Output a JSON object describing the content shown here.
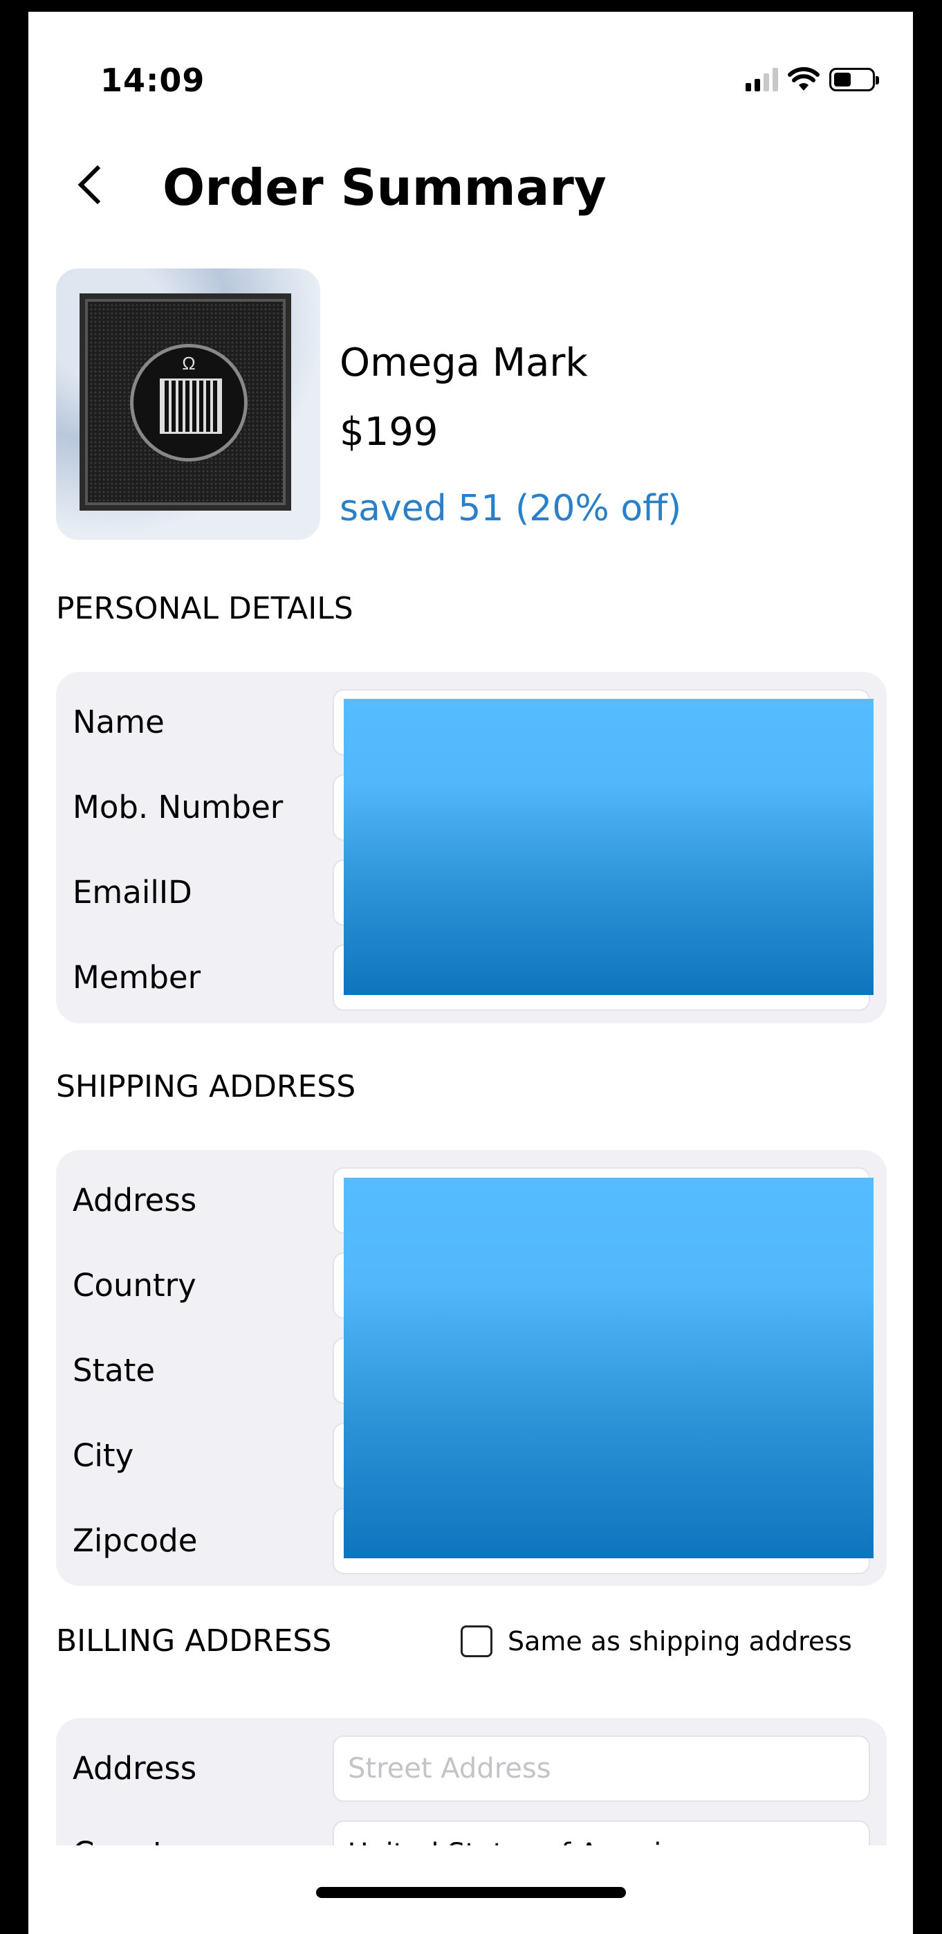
{
  "status_bar": {
    "time": "14:09"
  },
  "header": {
    "title": "Order Summary"
  },
  "product": {
    "name": "Omega Mark",
    "price": "$199",
    "savings": "saved 51 (20% off)",
    "image_symbol": "Ω"
  },
  "personal_details": {
    "title": "PERSONAL DETAILS",
    "fields": [
      {
        "label": "Name"
      },
      {
        "label": "Mob. Number"
      },
      {
        "label": "EmailID"
      },
      {
        "label": "Member"
      }
    ]
  },
  "shipping_address": {
    "title": "SHIPPING ADDRESS",
    "fields": [
      {
        "label": "Address"
      },
      {
        "label": "Country"
      },
      {
        "label": "State"
      },
      {
        "label": "City"
      },
      {
        "label": "Zipcode"
      }
    ]
  },
  "billing_address": {
    "title": "BILLING ADDRESS",
    "same_as_shipping_label": "Same as shipping address",
    "same_as_shipping_checked": false,
    "fields": [
      {
        "label": "Address",
        "placeholder": "Street Address",
        "value": ""
      },
      {
        "label": "Country",
        "value": "United States of America"
      }
    ]
  },
  "colors": {
    "accent": "#2a7fc9",
    "card_background": "#f0f0f5",
    "redaction_top": "#55bcff",
    "redaction_bottom": "#0e74bd"
  },
  "icons": {
    "back": "chevron-left-icon",
    "signal": "cellular-signal-icon",
    "wifi": "wifi-icon",
    "battery": "battery-icon"
  }
}
